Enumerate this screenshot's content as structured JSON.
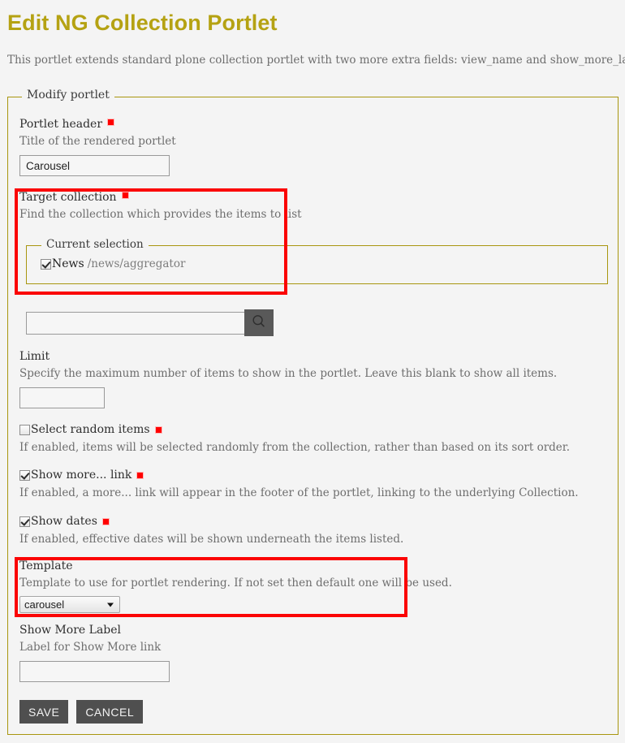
{
  "page": {
    "title": "Edit NG Collection Portlet",
    "description": "This portlet extends standard plone collection portlet with two more extra fields: view_name and show_more_label",
    "title_color": "#b5a213",
    "annotation_color": "#fb0404",
    "fieldset_border_color": "#a8960f"
  },
  "fieldset": {
    "legend": "Modify portlet"
  },
  "fields": {
    "portlet_header": {
      "label": "Portlet header",
      "required": true,
      "help": "Title of the rendered portlet",
      "value": "Carousel",
      "placeholder": ""
    },
    "target_collection": {
      "label": "Target collection",
      "required": true,
      "help": "Find the collection which provides the items to list",
      "current_selection_legend": "Current selection",
      "selection": {
        "checked": true,
        "name": "News",
        "path": "/news/aggregator"
      },
      "search": {
        "value": "",
        "placeholder": "",
        "button_icon": "search-icon"
      }
    },
    "limit": {
      "label": "Limit",
      "required": false,
      "help": "Specify the maximum number of items to show in the portlet. Leave this blank to show all items.",
      "value": "",
      "placeholder": ""
    },
    "select_random": {
      "label": "Select random items",
      "required": true,
      "checked": false,
      "help": "If enabled, items will be selected randomly from the collection, rather than based on its sort order."
    },
    "show_more_link": {
      "label": "Show more... link",
      "required": true,
      "checked": true,
      "help": "If enabled, a more... link will appear in the footer of the portlet, linking to the underlying Collection."
    },
    "show_dates": {
      "label": "Show dates",
      "required": true,
      "checked": true,
      "help": "If enabled, effective dates will be shown underneath the items listed."
    },
    "template": {
      "label": "Template",
      "required": false,
      "help": "Template to use for portlet rendering. If not set then default one will be used.",
      "selected": "carousel",
      "options": [
        "carousel"
      ]
    },
    "show_more_label": {
      "label": "Show More Label",
      "required": false,
      "help": "Label for Show More link",
      "value": "",
      "placeholder": ""
    }
  },
  "actions": {
    "save": "SAVE",
    "cancel": "CANCEL"
  }
}
